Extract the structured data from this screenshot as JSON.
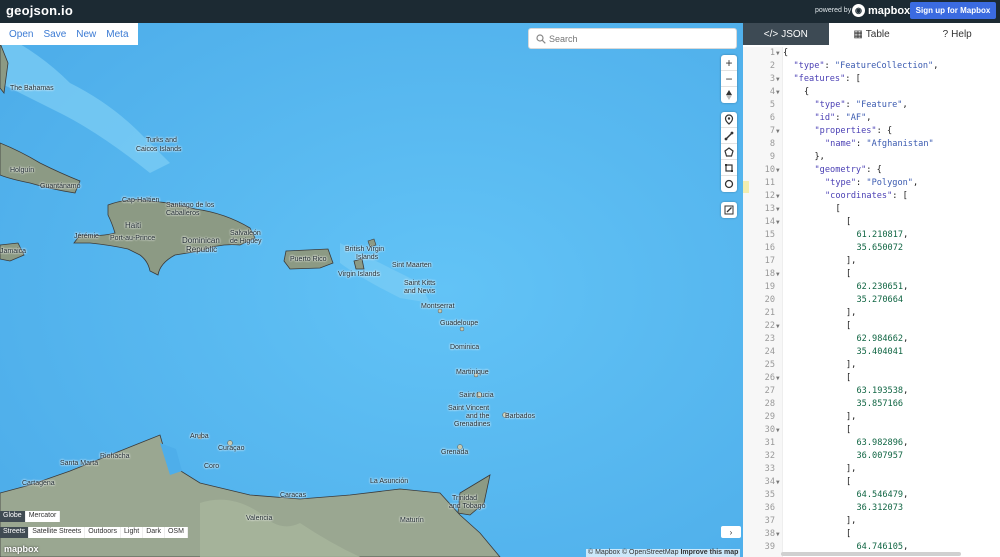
{
  "app": {
    "brand": "geojson.io",
    "powered_by": "powered by",
    "mapbox_word": "mapbox",
    "signup_label": "Sign up for Mapbox"
  },
  "menu": [
    "Open",
    "Save",
    "New",
    "Meta"
  ],
  "search": {
    "placeholder": "Search"
  },
  "map": {
    "places": [
      {
        "label": "The Bahamas",
        "cls": "place"
      },
      {
        "label": "Turks and",
        "cls": "place"
      },
      {
        "label": "Caicos Islands",
        "cls": "place"
      },
      {
        "label": "Holguín",
        "cls": "place"
      },
      {
        "label": "Guantánamo",
        "cls": "place"
      },
      {
        "label": "Cap-Haïtien",
        "cls": "place"
      },
      {
        "label": "Santiago de los",
        "cls": "place"
      },
      {
        "label": "Caballeros",
        "cls": "place"
      },
      {
        "label": "Haiti",
        "cls": "place"
      },
      {
        "label": "Jérémie",
        "cls": "place"
      },
      {
        "label": "Port-au-Prince",
        "cls": "place"
      },
      {
        "label": "Dominican",
        "cls": "place"
      },
      {
        "label": "Republic",
        "cls": "place"
      },
      {
        "label": "Salvaleón",
        "cls": "place"
      },
      {
        "label": "de Higüey",
        "cls": "place"
      },
      {
        "label": "Puerto Rico",
        "cls": "place"
      },
      {
        "label": "British Virgin",
        "cls": "place"
      },
      {
        "label": "Islands",
        "cls": "place"
      },
      {
        "label": "Virgin Islands",
        "cls": "place"
      },
      {
        "label": "Sint Maarten",
        "cls": "place"
      },
      {
        "label": "Saint Kitts",
        "cls": "place"
      },
      {
        "label": "and Nevis",
        "cls": "place"
      },
      {
        "label": "Montserrat",
        "cls": "place"
      },
      {
        "label": "Guadeloupe",
        "cls": "place"
      },
      {
        "label": "Dominica",
        "cls": "place"
      },
      {
        "label": "Martinique",
        "cls": "place"
      },
      {
        "label": "Saint Lucia",
        "cls": "place"
      },
      {
        "label": "Saint Vincent",
        "cls": "place"
      },
      {
        "label": "and the",
        "cls": "place"
      },
      {
        "label": "Grenadines",
        "cls": "place"
      },
      {
        "label": "Barbados",
        "cls": "place"
      },
      {
        "label": "Grenada",
        "cls": "place"
      },
      {
        "label": "Aruba",
        "cls": "place"
      },
      {
        "label": "Curaçao",
        "cls": "place"
      },
      {
        "label": "Riohacha",
        "cls": "place"
      },
      {
        "label": "Santa Marta",
        "cls": "place"
      },
      {
        "label": "Coro",
        "cls": "place"
      },
      {
        "label": "Cartagena",
        "cls": "place"
      },
      {
        "label": "La Asunción",
        "cls": "place"
      },
      {
        "label": "Caracas",
        "cls": "place"
      },
      {
        "label": "Trinidad",
        "cls": "place"
      },
      {
        "label": "and Tobago",
        "cls": "place"
      },
      {
        "label": "Valencia",
        "cls": "place"
      },
      {
        "label": "Maturín",
        "cls": "place"
      },
      {
        "label": "Jamaica",
        "cls": "place"
      }
    ],
    "projection_toggles": [
      "Globe",
      "Mercator"
    ],
    "style_toggles": [
      "Streets",
      "Satellite Streets",
      "Outdoors",
      "Light",
      "Dark",
      "OSM"
    ],
    "attribution": "© Mapbox © OpenStreetMap",
    "improve": "Improve this map",
    "map_logo": "mapbox"
  },
  "panel": {
    "tabs": [
      {
        "icon": "</>",
        "label": "JSON"
      },
      {
        "icon": "▦",
        "label": "Table"
      },
      {
        "icon": "?",
        "label": "Help"
      }
    ]
  },
  "code_lines": [
    {
      "n": "1",
      "fold": true,
      "indent": 0,
      "parts": [
        [
          "p",
          "{"
        ]
      ]
    },
    {
      "n": "2",
      "fold": false,
      "indent": 1,
      "parts": [
        [
          "k",
          "\"type\""
        ],
        [
          "p",
          ": "
        ],
        [
          "s",
          "\"FeatureCollection\""
        ],
        [
          "p",
          ","
        ]
      ]
    },
    {
      "n": "3",
      "fold": true,
      "indent": 1,
      "parts": [
        [
          "k",
          "\"features\""
        ],
        [
          "p",
          ": ["
        ]
      ]
    },
    {
      "n": "4",
      "fold": true,
      "indent": 2,
      "parts": [
        [
          "p",
          "{"
        ]
      ]
    },
    {
      "n": "5",
      "fold": false,
      "indent": 3,
      "parts": [
        [
          "k",
          "\"type\""
        ],
        [
          "p",
          ": "
        ],
        [
          "s",
          "\"Feature\""
        ],
        [
          "p",
          ","
        ]
      ]
    },
    {
      "n": "6",
      "fold": false,
      "indent": 3,
      "parts": [
        [
          "k",
          "\"id\""
        ],
        [
          "p",
          ": "
        ],
        [
          "s",
          "\"AF\""
        ],
        [
          "p",
          ","
        ]
      ]
    },
    {
      "n": "7",
      "fold": true,
      "indent": 3,
      "parts": [
        [
          "k",
          "\"properties\""
        ],
        [
          "p",
          ": {"
        ]
      ]
    },
    {
      "n": "8",
      "fold": false,
      "indent": 4,
      "parts": [
        [
          "k",
          "\"name\""
        ],
        [
          "p",
          ": "
        ],
        [
          "s",
          "\"Afghanistan\""
        ]
      ]
    },
    {
      "n": "9",
      "fold": false,
      "indent": 3,
      "parts": [
        [
          "p",
          "},"
        ]
      ]
    },
    {
      "n": "10",
      "fold": true,
      "indent": 3,
      "parts": [
        [
          "k",
          "\"geometry\""
        ],
        [
          "p",
          ": {"
        ]
      ]
    },
    {
      "n": "11",
      "fold": false,
      "indent": 4,
      "parts": [
        [
          "k",
          "\"type\""
        ],
        [
          "p",
          ": "
        ],
        [
          "s",
          "\"Polygon\""
        ],
        [
          "p",
          ","
        ]
      ]
    },
    {
      "n": "12",
      "fold": true,
      "indent": 4,
      "parts": [
        [
          "k",
          "\"coordinates\""
        ],
        [
          "p",
          ": ["
        ]
      ]
    },
    {
      "n": "13",
      "fold": true,
      "indent": 5,
      "parts": [
        [
          "p",
          "["
        ]
      ]
    },
    {
      "n": "14",
      "fold": true,
      "indent": 6,
      "parts": [
        [
          "p",
          "["
        ]
      ]
    },
    {
      "n": "15",
      "fold": false,
      "indent": 7,
      "parts": [
        [
          "n",
          "61.210817"
        ],
        [
          "p",
          ","
        ]
      ]
    },
    {
      "n": "16",
      "fold": false,
      "indent": 7,
      "parts": [
        [
          "n",
          "35.650072"
        ]
      ]
    },
    {
      "n": "17",
      "fold": false,
      "indent": 6,
      "parts": [
        [
          "p",
          "],"
        ]
      ]
    },
    {
      "n": "18",
      "fold": true,
      "indent": 6,
      "parts": [
        [
          "p",
          "["
        ]
      ]
    },
    {
      "n": "19",
      "fold": false,
      "indent": 7,
      "parts": [
        [
          "n",
          "62.230651"
        ],
        [
          "p",
          ","
        ]
      ]
    },
    {
      "n": "20",
      "fold": false,
      "indent": 7,
      "parts": [
        [
          "n",
          "35.270664"
        ]
      ]
    },
    {
      "n": "21",
      "fold": false,
      "indent": 6,
      "parts": [
        [
          "p",
          "],"
        ]
      ]
    },
    {
      "n": "22",
      "fold": true,
      "indent": 6,
      "parts": [
        [
          "p",
          "["
        ]
      ]
    },
    {
      "n": "23",
      "fold": false,
      "indent": 7,
      "parts": [
        [
          "n",
          "62.984662"
        ],
        [
          "p",
          ","
        ]
      ]
    },
    {
      "n": "24",
      "fold": false,
      "indent": 7,
      "parts": [
        [
          "n",
          "35.404041"
        ]
      ]
    },
    {
      "n": "25",
      "fold": false,
      "indent": 6,
      "parts": [
        [
          "p",
          "],"
        ]
      ]
    },
    {
      "n": "26",
      "fold": true,
      "indent": 6,
      "parts": [
        [
          "p",
          "["
        ]
      ]
    },
    {
      "n": "27",
      "fold": false,
      "indent": 7,
      "parts": [
        [
          "n",
          "63.193538"
        ],
        [
          "p",
          ","
        ]
      ]
    },
    {
      "n": "28",
      "fold": false,
      "indent": 7,
      "parts": [
        [
          "n",
          "35.857166"
        ]
      ]
    },
    {
      "n": "29",
      "fold": false,
      "indent": 6,
      "parts": [
        [
          "p",
          "],"
        ]
      ]
    },
    {
      "n": "30",
      "fold": true,
      "indent": 6,
      "parts": [
        [
          "p",
          "["
        ]
      ]
    },
    {
      "n": "31",
      "fold": false,
      "indent": 7,
      "parts": [
        [
          "n",
          "63.982896"
        ],
        [
          "p",
          ","
        ]
      ]
    },
    {
      "n": "32",
      "fold": false,
      "indent": 7,
      "parts": [
        [
          "n",
          "36.007957"
        ]
      ]
    },
    {
      "n": "33",
      "fold": false,
      "indent": 6,
      "parts": [
        [
          "p",
          "],"
        ]
      ]
    },
    {
      "n": "34",
      "fold": true,
      "indent": 6,
      "parts": [
        [
          "p",
          "["
        ]
      ]
    },
    {
      "n": "35",
      "fold": false,
      "indent": 7,
      "parts": [
        [
          "n",
          "64.546479"
        ],
        [
          "p",
          ","
        ]
      ]
    },
    {
      "n": "36",
      "fold": false,
      "indent": 7,
      "parts": [
        [
          "n",
          "36.312073"
        ]
      ]
    },
    {
      "n": "37",
      "fold": false,
      "indent": 6,
      "parts": [
        [
          "p",
          "],"
        ]
      ]
    },
    {
      "n": "38",
      "fold": true,
      "indent": 6,
      "parts": [
        [
          "p",
          "["
        ]
      ]
    },
    {
      "n": "39",
      "fold": false,
      "indent": 7,
      "parts": [
        [
          "n",
          "64.746105"
        ],
        [
          "p",
          ","
        ]
      ]
    }
  ]
}
